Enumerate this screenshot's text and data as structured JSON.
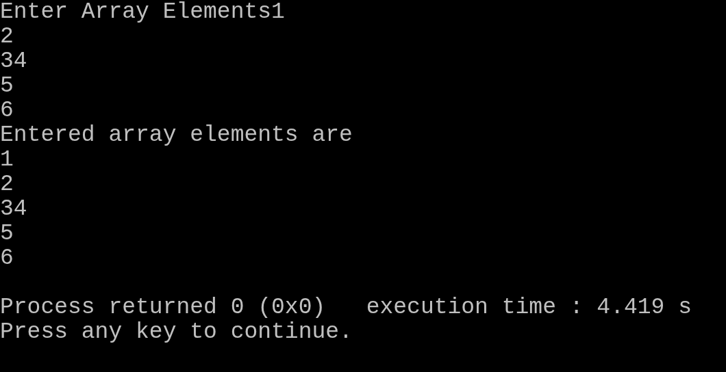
{
  "console": {
    "output_lines": [
      "Enter Array Elements1",
      "2",
      "34",
      "5",
      "6",
      "Entered array elements are",
      "1",
      "2",
      "34",
      "5",
      "6"
    ],
    "status_lines": [
      "Process returned 0 (0x0)   execution time : 4.419 s",
      "Press any key to continue."
    ]
  }
}
